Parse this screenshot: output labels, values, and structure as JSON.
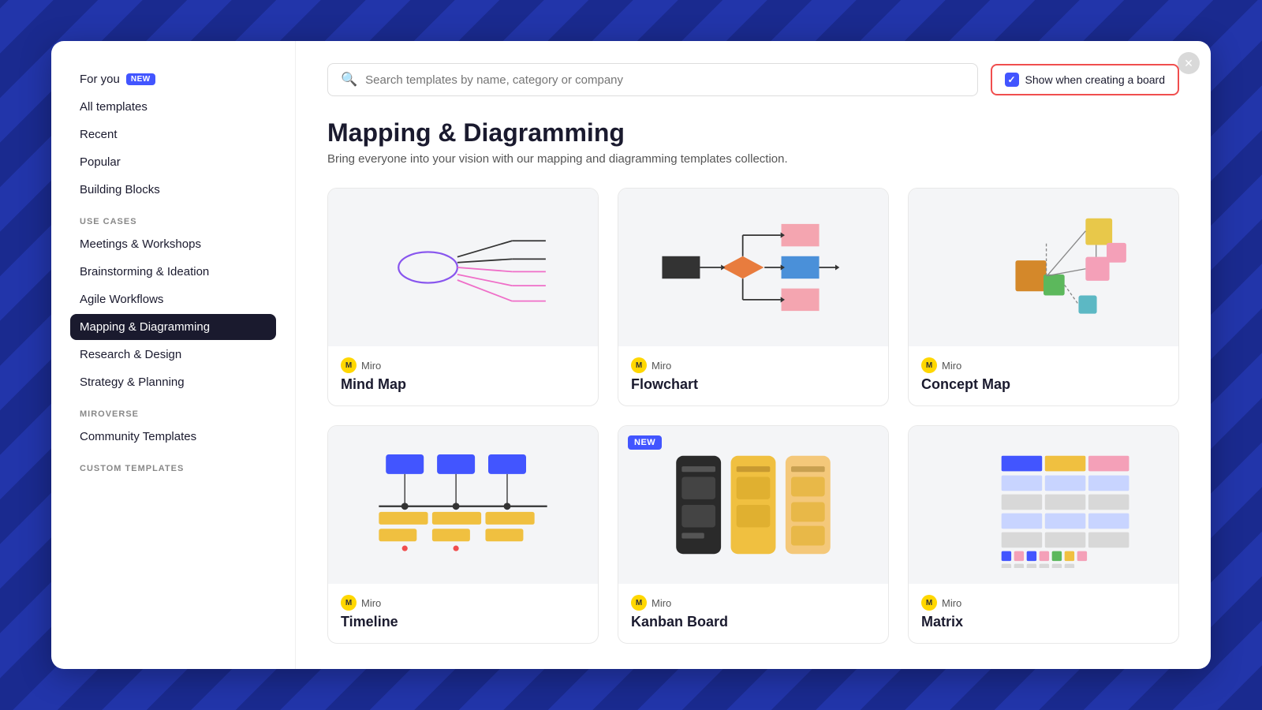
{
  "background": {
    "color": "#1a2a8f"
  },
  "sidebar": {
    "top_items": [
      {
        "id": "for-you",
        "label": "For you",
        "badge": "NEW",
        "active": false
      },
      {
        "id": "all-templates",
        "label": "All templates",
        "active": false
      },
      {
        "id": "recent",
        "label": "Recent",
        "active": false
      },
      {
        "id": "popular",
        "label": "Popular",
        "active": false
      },
      {
        "id": "building-blocks",
        "label": "Building Blocks",
        "active": false
      }
    ],
    "use_cases_label": "USE CASES",
    "use_cases": [
      {
        "id": "meetings-workshops",
        "label": "Meetings & Workshops",
        "active": false
      },
      {
        "id": "brainstorming",
        "label": "Brainstorming & Ideation",
        "active": false
      },
      {
        "id": "agile-workflows",
        "label": "Agile Workflows",
        "active": false
      },
      {
        "id": "mapping-diagramming",
        "label": "Mapping & Diagramming",
        "active": true
      },
      {
        "id": "research-design",
        "label": "Research & Design",
        "active": false
      },
      {
        "id": "strategy-planning",
        "label": "Strategy & Planning",
        "active": false
      }
    ],
    "miroverse_label": "MIROVERSE",
    "miroverse_items": [
      {
        "id": "community-templates",
        "label": "Community Templates",
        "active": false
      }
    ],
    "custom_label": "CUSTOM TEMPLATES"
  },
  "header": {
    "search_placeholder": "Search templates by name, category or company",
    "show_creating_label": "Show when creating a board"
  },
  "main": {
    "category_title": "Mapping & Diagramming",
    "category_desc": "Bring everyone into your vision with our mapping and diagramming templates collection.",
    "templates": [
      {
        "id": "mind-map",
        "author": "Miro",
        "name": "Mind Map",
        "is_new": false
      },
      {
        "id": "flowchart",
        "author": "Miro",
        "name": "Flowchart",
        "is_new": false
      },
      {
        "id": "concept-map",
        "author": "Miro",
        "name": "Concept Map",
        "is_new": false
      },
      {
        "id": "timeline",
        "author": "Miro",
        "name": "Timeline",
        "is_new": false
      },
      {
        "id": "kanban",
        "author": "Miro",
        "name": "Kanban Board",
        "is_new": true
      },
      {
        "id": "matrix",
        "author": "Miro",
        "name": "Matrix",
        "is_new": false
      }
    ]
  },
  "close_btn": "✕"
}
